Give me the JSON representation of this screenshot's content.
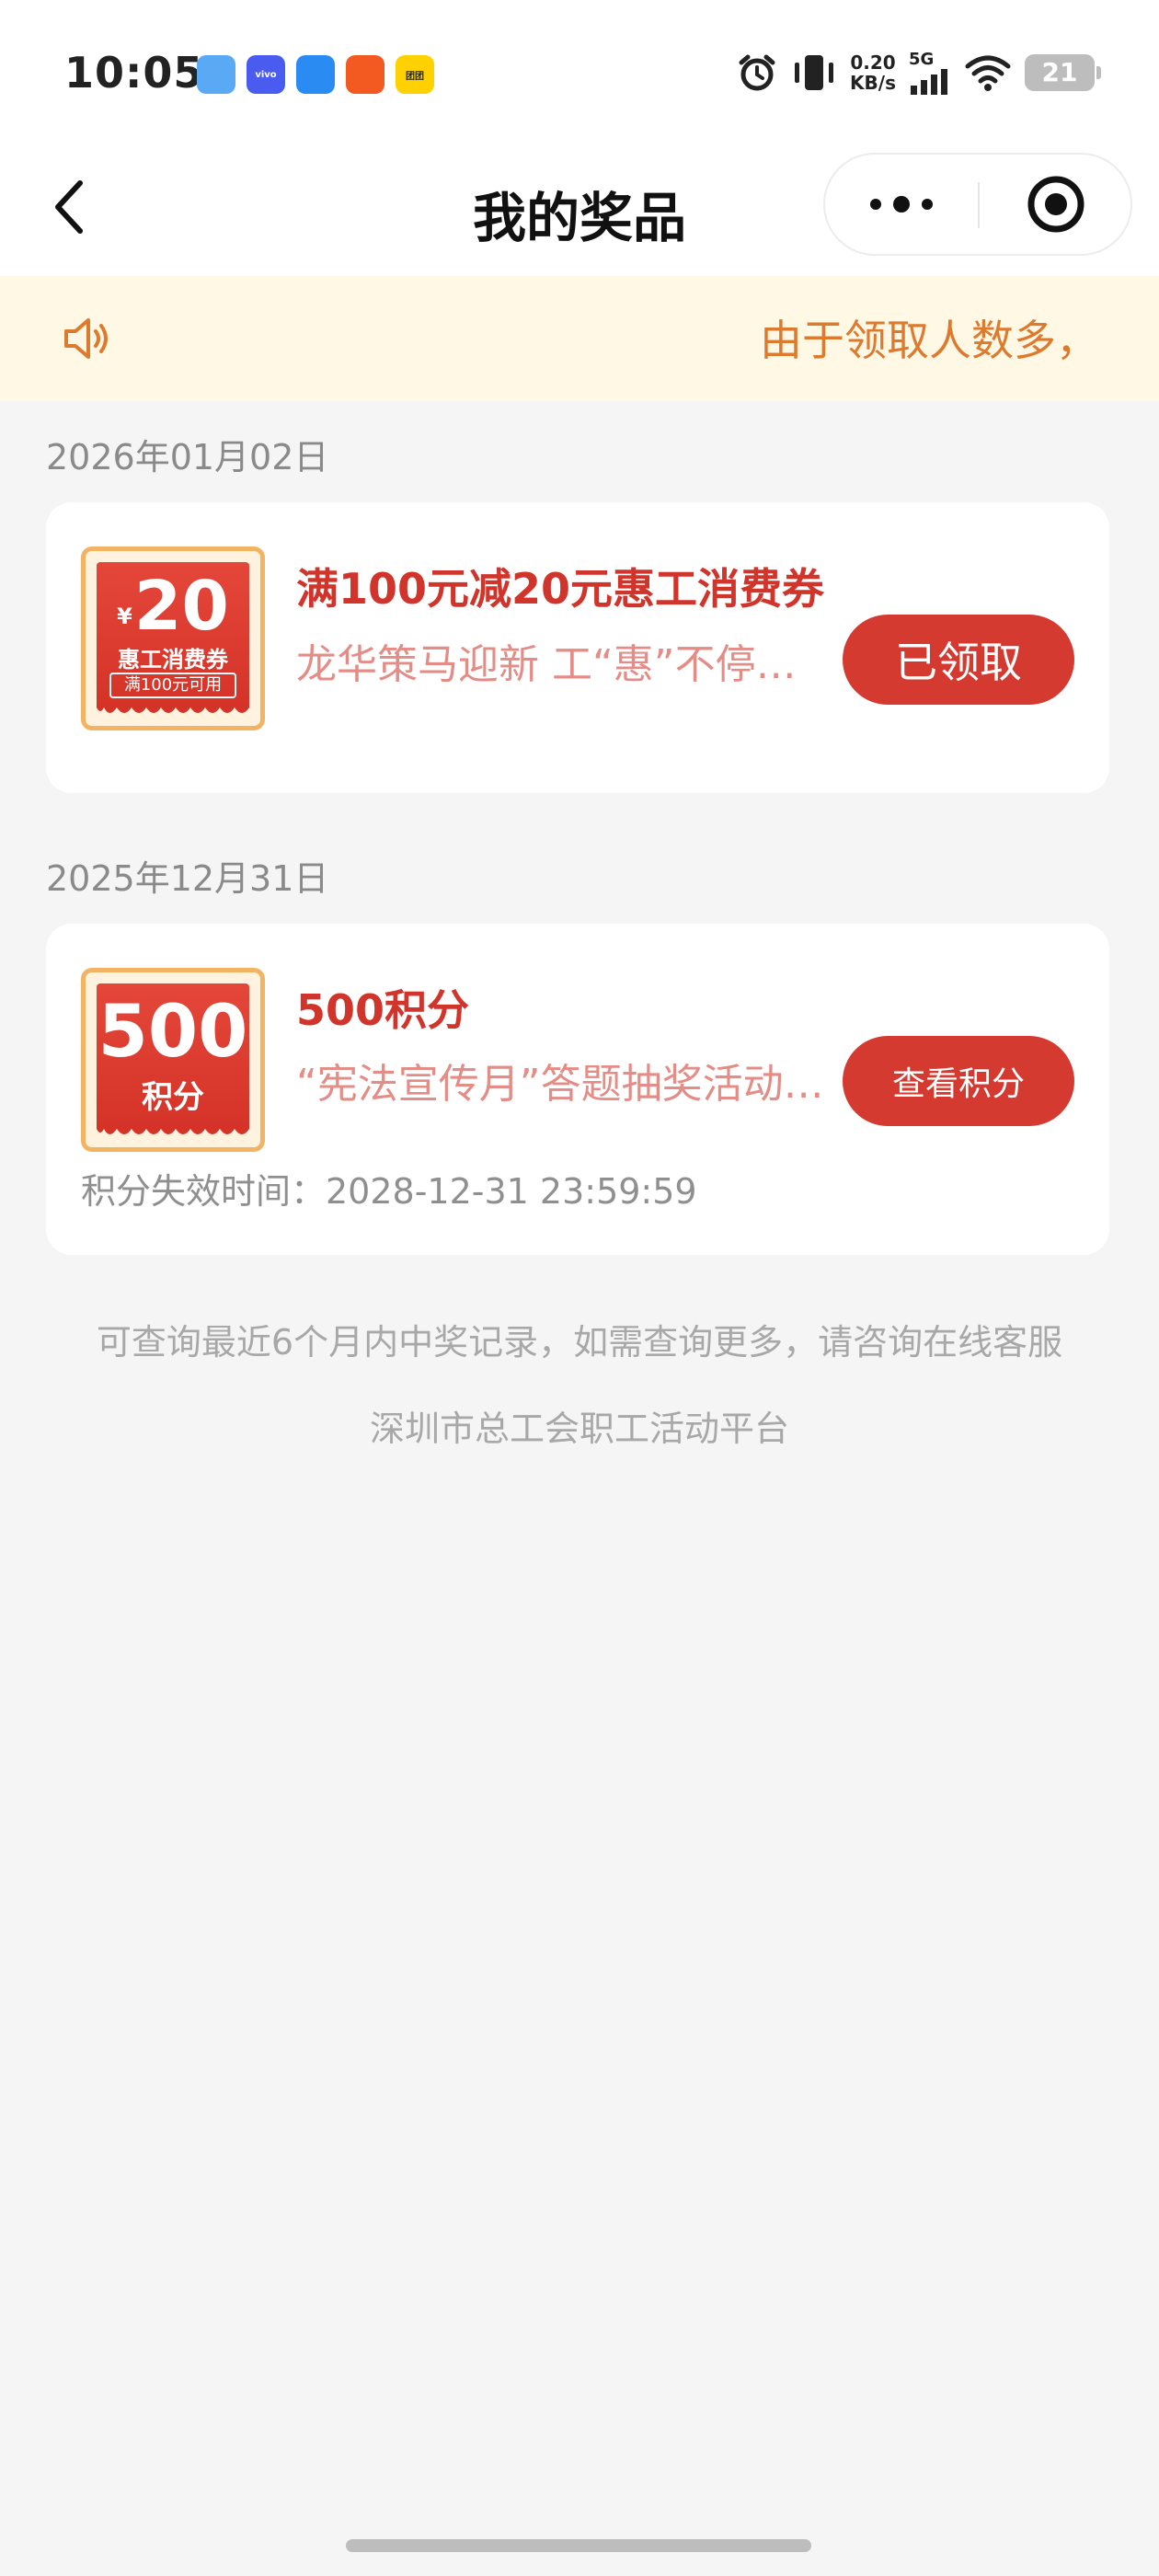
{
  "status_bar": {
    "time": "10:05",
    "apps": [
      {
        "name": "assistant-app-icon",
        "color": "#5aa9f5",
        "label": ""
      },
      {
        "name": "vivo-app-icon",
        "color": "#4a5cf0",
        "label": "vivo"
      },
      {
        "name": "message-app-icon",
        "color": "#2a8cf2",
        "label": ""
      },
      {
        "name": "kuaishou-app-icon",
        "color": "#f25a22",
        "label": ""
      },
      {
        "name": "meituan-app-icon",
        "color": "#ffd100",
        "label": "团团"
      }
    ],
    "net_speed_value": "0.20",
    "net_speed_unit": "KB/s",
    "network": "5G",
    "battery": "21"
  },
  "nav": {
    "title": "我的奖品"
  },
  "notice": {
    "text": "由于领取人数多，"
  },
  "prizes": [
    {
      "date": "2026年01月02日",
      "title": "满100元减20元惠工消费券",
      "description": "龙华策马迎新 工“惠”不停…",
      "button": "已领取",
      "badge": {
        "currency": "¥",
        "amount": "20",
        "name": "惠工消费券",
        "condition": "满100元可用"
      }
    },
    {
      "date": "2025年12月31日",
      "title": "500积分",
      "description": "“宪法宣传月”答题抽奖活动…",
      "button": "查看积分",
      "badge": {
        "amount": "500",
        "unit": "积分"
      },
      "expire_text": "积分失效时间：2028-12-31 23:59:59"
    }
  ],
  "footer": {
    "note": "可查询最近6个月内中奖记录，如需查询更多，请咨询在线客服",
    "platform": "深圳市总工会职工活动平台"
  },
  "colors": {
    "primary_red": "#d53a31",
    "notice_bg": "#fff8e4",
    "notice_text": "#de7a2e"
  }
}
